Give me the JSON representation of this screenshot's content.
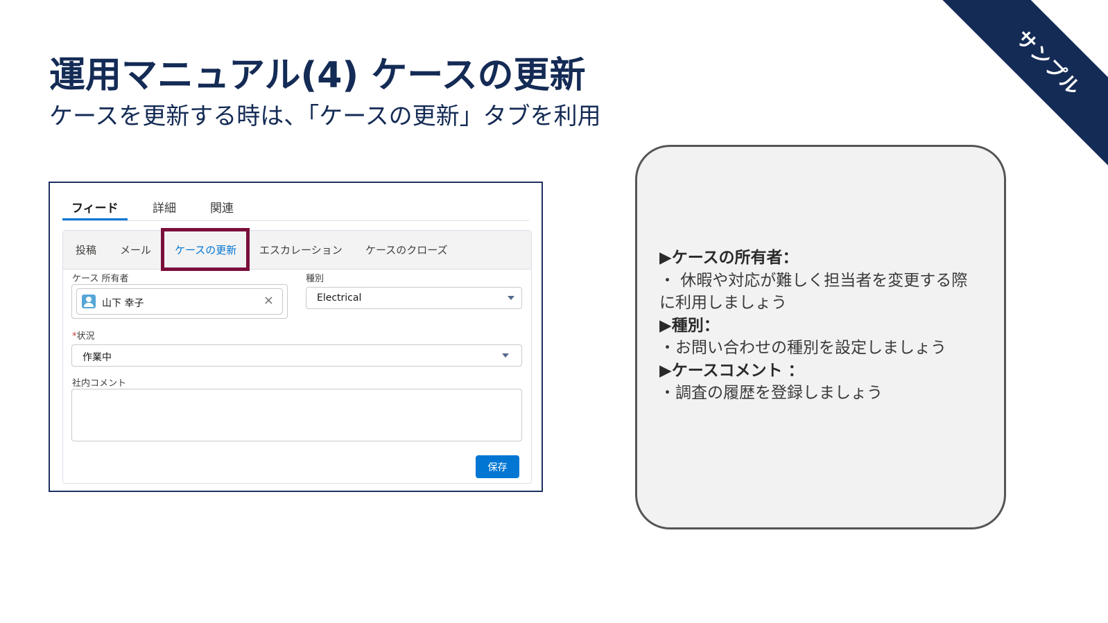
{
  "slide": {
    "title": "運用マニュアル(4) ケースの更新",
    "subtitle": "ケースを更新する時は、「ケースの更新」タブを利用",
    "ribbon": "サンプル"
  },
  "screenshot": {
    "top_tabs": [
      {
        "label": "フィード",
        "active": true
      },
      {
        "label": "詳細",
        "active": false
      },
      {
        "label": "関連",
        "active": false
      }
    ],
    "sub_tabs": [
      {
        "label": "投稿",
        "active": false
      },
      {
        "label": "メール",
        "active": false
      },
      {
        "label": "ケースの更新",
        "active": true
      },
      {
        "label": "エスカレーション",
        "active": false
      },
      {
        "label": "ケースのクローズ",
        "active": false
      }
    ],
    "owner": {
      "label": "ケース 所有者",
      "value": "山下 幸子",
      "clear_glyph": "×"
    },
    "type": {
      "label": "種別",
      "value": "Electrical"
    },
    "status": {
      "required_mark": "*",
      "label": "状況",
      "value": "作業中"
    },
    "comment": {
      "label": "社内コメント",
      "value": ""
    },
    "save_label": "保存"
  },
  "info": {
    "lines": [
      {
        "text": "▶ケースの所有者：",
        "heading": true
      },
      {
        "text": "・ 休暇や対応が難しく担当者を変更する際",
        "heading": false
      },
      {
        "text": "に利用しましょう",
        "heading": false
      },
      {
        "text": "▶種別：",
        "heading": true
      },
      {
        "text": "・お問い合わせの種別を設定しましょう",
        "heading": false
      },
      {
        "text": "▶ケースコメント ：",
        "heading": true
      },
      {
        "text": "・調査の履歴を登録しましょう",
        "heading": false
      }
    ]
  },
  "colors": {
    "navy": "#142b55",
    "brand_blue": "#0176d3",
    "highlight": "#7a0f3b"
  }
}
